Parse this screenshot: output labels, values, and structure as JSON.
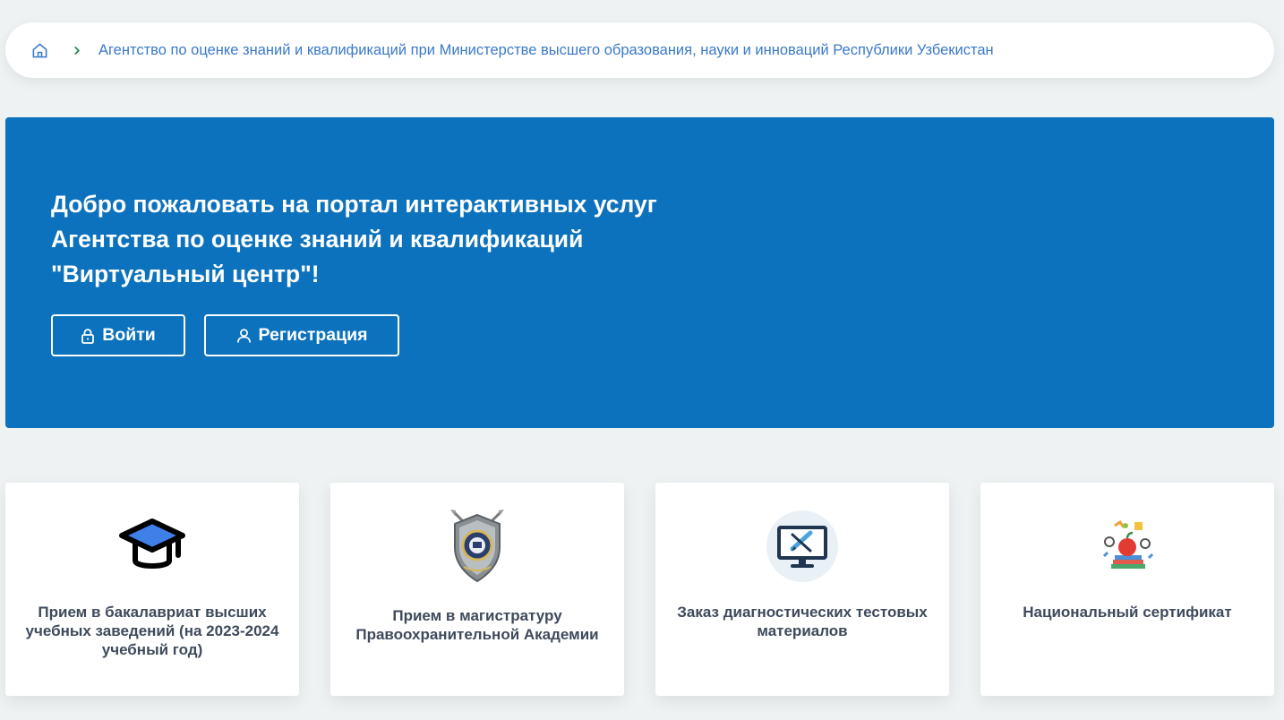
{
  "breadcrumb": {
    "home_icon": "home-icon",
    "separator_icon": "chevron-right-icon",
    "current": "Агентство по оценке знаний и квалификаций при Министерстве высшего образования, науки и инноваций Республики Узбекистан"
  },
  "hero": {
    "title_lines": [
      "Добро пожаловать на портал интерактивных услуг",
      "Агентства по оценке знаний и квалификаций",
      "\"Виртуальный центр\"!"
    ],
    "login_label": "Войти",
    "login_icon": "lock-icon",
    "register_label": "Регистрация",
    "register_icon": "user-icon",
    "background_color": "#0c72bd"
  },
  "cards": [
    {
      "icon": "graduation-cap-icon",
      "label": "Прием в бакалавриат высших учебных заведений (на 2023-2024 учебный год)"
    },
    {
      "icon": "academy-shield-emblem",
      "label": "Прием в магистратуру Правоохранительной Академии"
    },
    {
      "icon": "monitor-test-icon",
      "label": "Заказ диагностических тестовых материалов"
    },
    {
      "icon": "certificate-apple-icon",
      "label": "Национальный сертификат"
    }
  ],
  "colors": {
    "accent": "#0c72bd",
    "link": "#3b79c9",
    "separator": "#2e8b57",
    "card_text": "#3e4a5c",
    "page_bg": "#eef2f3"
  }
}
